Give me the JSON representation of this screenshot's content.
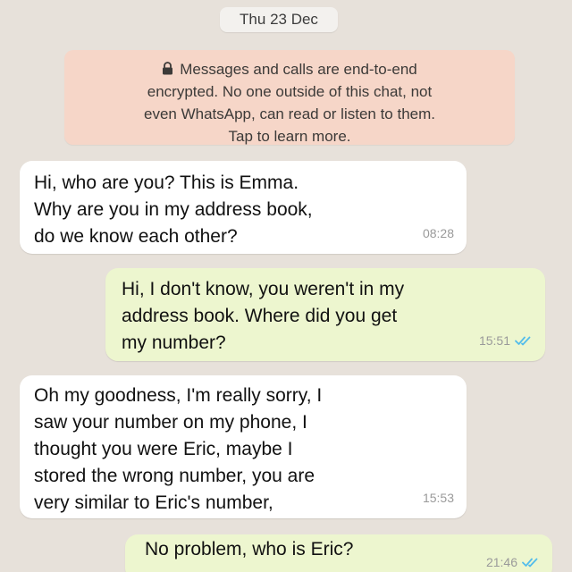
{
  "date_divider": "Thu 23 Dec",
  "encryption_notice": {
    "lines": [
      "Messages and calls are end-to-end",
      "encrypted. No one outside of this chat, not",
      "even WhatsApp, can read or listen to them.",
      "Tap to learn more."
    ],
    "icon": "lock-icon"
  },
  "messages": [
    {
      "direction": "incoming",
      "lines": [
        "Hi, who are you? This is Emma.",
        "Why are you in my address book,",
        "do we know each other?"
      ],
      "time": "08:28"
    },
    {
      "direction": "outgoing",
      "lines": [
        "Hi, I don't know, you weren't in my",
        "address book. Where did you get",
        "my number?"
      ],
      "time": "15:51",
      "status": "read",
      "status_icon": "double-check-icon"
    },
    {
      "direction": "incoming",
      "lines": [
        "Oh my goodness, I'm really sorry, I",
        "saw your number on my phone, I",
        "thought you were Eric, maybe I",
        "stored the wrong number, you are",
        "very similar to Eric's number,"
      ],
      "time": "15:53"
    },
    {
      "direction": "outgoing",
      "lines": [
        "No problem, who is Eric?"
      ],
      "time": "21:46",
      "status": "read",
      "status_icon": "double-check-icon"
    }
  ],
  "colors": {
    "chat_background": "#e7e1da",
    "incoming_bubble": "#ffffff",
    "outgoing_bubble": "#edf6cf",
    "notice_background": "#f6d6c8",
    "read_ticks": "#53bdeb",
    "timestamp": "#9a9a9a"
  }
}
